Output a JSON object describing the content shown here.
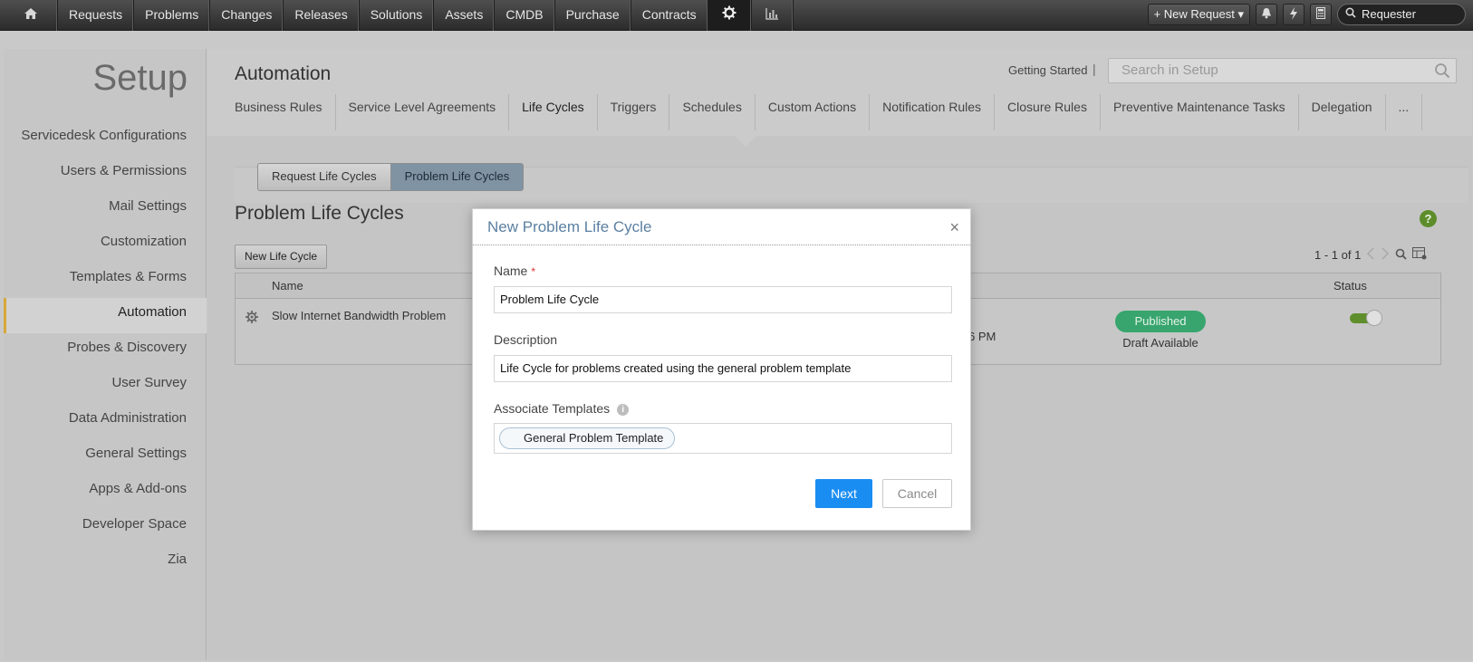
{
  "topnav": {
    "items": [
      "Requests",
      "Problems",
      "Changes",
      "Releases",
      "Solutions",
      "Assets",
      "CMDB",
      "Purchase",
      "Contracts"
    ],
    "new_request": "+ New Request",
    "requester_search": "Requester",
    "icons": [
      "home-icon",
      "gear-icon",
      "bar-chart-icon",
      "bell-icon",
      "lightning-icon",
      "calculator-icon",
      "search-icon"
    ]
  },
  "sidebar": {
    "title": "Setup",
    "items": [
      {
        "label": "Servicedesk Configurations"
      },
      {
        "label": "Users & Permissions"
      },
      {
        "label": "Mail Settings"
      },
      {
        "label": "Customization"
      },
      {
        "label": "Templates & Forms"
      },
      {
        "label": "Automation"
      },
      {
        "label": "Probes & Discovery"
      },
      {
        "label": "User Survey"
      },
      {
        "label": "Data Administration"
      },
      {
        "label": "General Settings"
      },
      {
        "label": "Apps & Add-ons"
      },
      {
        "label": "Developer Space"
      },
      {
        "label": "Zia"
      }
    ],
    "active_index": 5
  },
  "header": {
    "title": "Automation",
    "getting_started": "Getting Started",
    "separator": "|",
    "search_placeholder": "Search in Setup"
  },
  "tabs": [
    {
      "label": "Business Rules"
    },
    {
      "label": "Service Level Agreements"
    },
    {
      "label": "Life Cycles"
    },
    {
      "label": "Triggers"
    },
    {
      "label": "Schedules"
    },
    {
      "label": "Custom Actions"
    },
    {
      "label": "Notification Rules"
    },
    {
      "label": "Closure Rules"
    },
    {
      "label": "Preventive Maintenance Tasks"
    },
    {
      "label": "Delegation"
    },
    {
      "label": "..."
    }
  ],
  "active_tab": "Life Cycles",
  "segment": {
    "options": [
      "Request Life Cycles",
      "Problem Life Cycles"
    ],
    "selected": "Problem Life Cycles"
  },
  "list": {
    "title": "Problem Life Cycles",
    "new_button": "New Life Cycle",
    "pagination": "1 - 1 of 1",
    "help": "?",
    "columns": {
      "name": "Name",
      "status": "Status"
    },
    "rows": [
      {
        "name": "Slow Internet Bandwidth Problem",
        "time_fragment": "6 PM",
        "badge": "Published",
        "draft": "Draft Available",
        "enabled": true
      }
    ]
  },
  "modal": {
    "title": "New Problem Life Cycle",
    "close": "×",
    "name_label": "Name",
    "required_mark": "*",
    "name_value": "Problem Life Cycle",
    "description_label": "Description",
    "description_value": "Life Cycle for problems created using the general problem template",
    "templates_label": "Associate Templates",
    "template_chip": "General Problem Template",
    "next": "Next",
    "cancel": "Cancel"
  },
  "colors": {
    "accent_blue": "#1a8df2",
    "published_green": "#37a56d",
    "toggle_green": "#5f8f2c",
    "active_marker": "#d7a83a",
    "modal_title": "#5b80a2"
  }
}
